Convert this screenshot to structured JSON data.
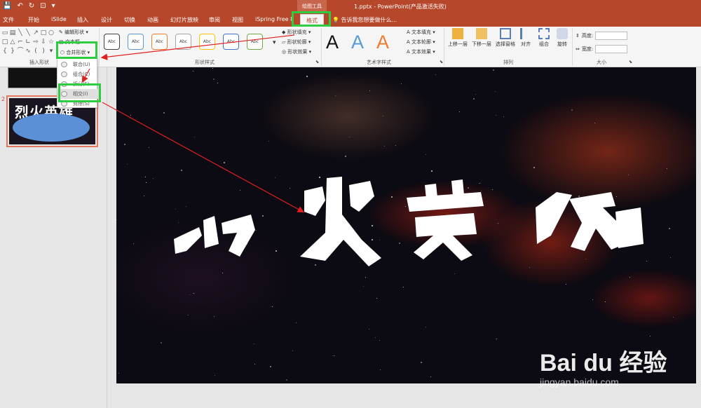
{
  "title_bar": {
    "contextual_label": "绘图工具",
    "doc_title": "1.pptx - PowerPoint(产品激活失败)"
  },
  "tabs": [
    "文件",
    "开始",
    "iSlide",
    "插入",
    "设计",
    "切换",
    "动画",
    "幻灯片放映",
    "审阅",
    "视图",
    "iSpring Free 8",
    "格式"
  ],
  "active_tab": "格式",
  "tell_me": "告诉我您想要做什么...",
  "ribbon": {
    "insert_shapes": {
      "label": "插入形状",
      "edit_shape": "编辑形状",
      "text_box": "文本框",
      "merge_shapes": "合并形状"
    },
    "shape_styles": {
      "label": "形状样式",
      "samples": [
        "Abc",
        "Abc",
        "Abc",
        "Abc",
        "Abc",
        "Abc",
        "Abc"
      ],
      "sample_colors": [
        "#404040",
        "#5b9bd5",
        "#ed7d31",
        "#a5a5a5",
        "#ffc000",
        "#4472c4",
        "#70ad47"
      ],
      "fill": "形状填充",
      "outline": "形状轮廓",
      "effects": "形状效果"
    },
    "wordart": {
      "label": "艺术字样式",
      "samples": [
        "A",
        "A",
        "A"
      ],
      "text_fill": "文本填充",
      "text_outline": "文本轮廓",
      "text_effects": "文本效果"
    },
    "arrange": {
      "label": "排列",
      "buttons": [
        "上移一层",
        "下移一层",
        "选择窗格",
        "对齐",
        "组合",
        "旋转"
      ]
    },
    "size": {
      "label": "大小",
      "height_label": "高度:",
      "width_label": "宽度:"
    }
  },
  "merge_menu": {
    "items": [
      "联合(U)",
      "组合(C)",
      "拆分(F)",
      "相交(I)",
      "剪除(S)"
    ],
    "selected": "相交(I)"
  },
  "thumbnails": {
    "slide2_number": "2",
    "slide2_text": "烈火英雄"
  },
  "watermark": {
    "logo": "Bai du 经验",
    "url": "jingyan.baidu.com"
  },
  "colors": {
    "accent": "#b7472a",
    "highlight": "#2ecc40",
    "annotation_arrow": "#e02020",
    "slide_text": "#ffffff"
  }
}
